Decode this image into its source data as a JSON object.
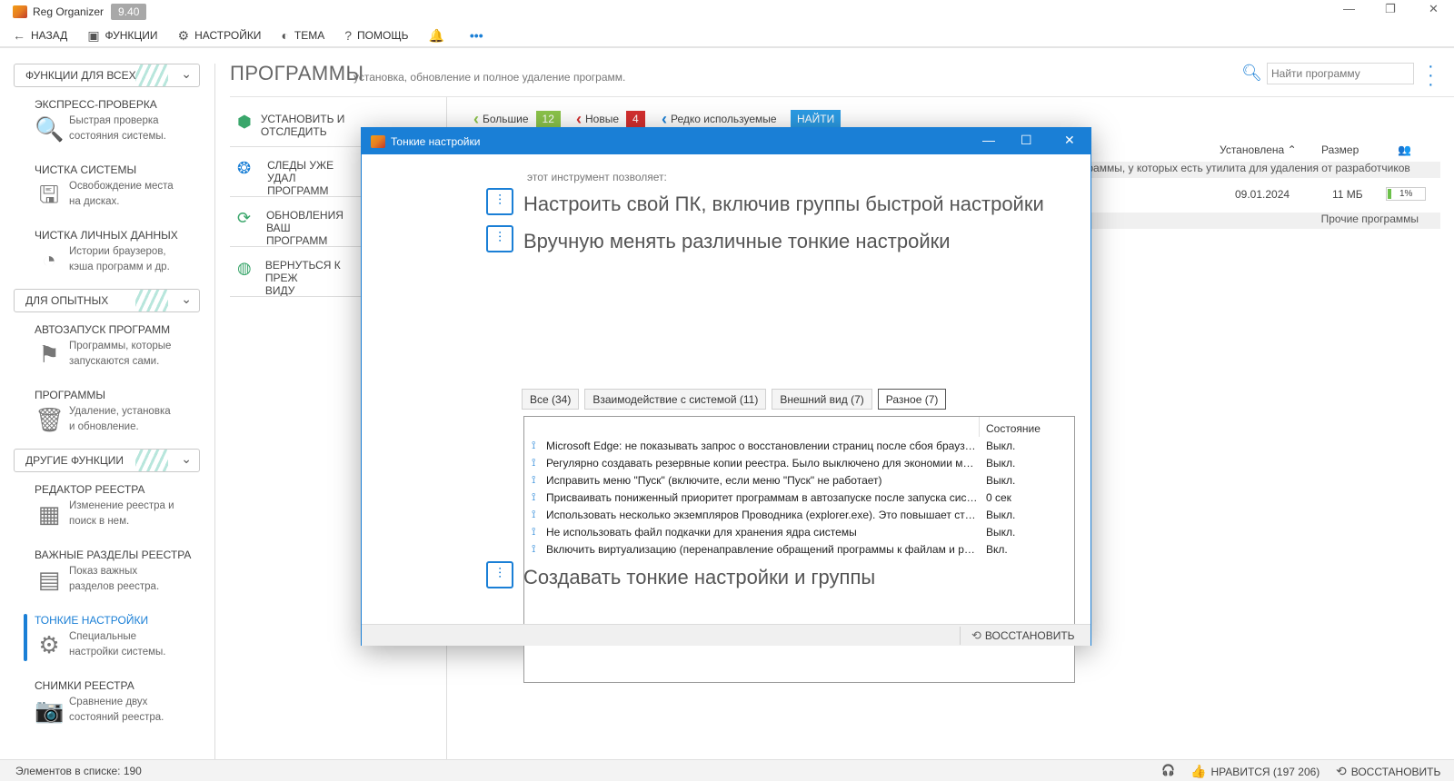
{
  "app": {
    "title": "Reg Organizer",
    "version": "9.40",
    "minimize": "—",
    "restore": "❐",
    "close": "✕"
  },
  "menu": [
    {
      "icon": "←",
      "label": "НАЗАД"
    },
    {
      "icon": "▣",
      "label": "ФУНКЦИИ"
    },
    {
      "icon": "⚙",
      "label": "НАСТРОЙКИ"
    },
    {
      "icon": "◐",
      "label": "ТЕМА"
    },
    {
      "icon": "?",
      "label": "ПОМОЩЬ"
    },
    {
      "icon": "🔔",
      "label": ""
    },
    {
      "icon": "•••",
      "label": ""
    }
  ],
  "sidebar": {
    "sections": [
      {
        "label": "ФУНКЦИИ ДЛЯ ВСЕХ"
      },
      {
        "label": "ДЛЯ ОПЫТНЫХ"
      },
      {
        "label": "ДРУГИЕ ФУНКЦИИ"
      }
    ],
    "items": [
      {
        "title": "ЭКСПРЕСС-ПРОВЕРКА",
        "desc1": "Быстрая проверка",
        "desc2": "состояния системы."
      },
      {
        "title": "ЧИСТКА СИСТЕМЫ",
        "desc1": "Освобождение места",
        "desc2": "на дисках."
      },
      {
        "title": "ЧИСТКА ЛИЧНЫХ ДАННЫХ",
        "desc1": "Истории браузеров,",
        "desc2": "кэша программ и др."
      },
      {
        "title": "АВТОЗАПУСК ПРОГРАММ",
        "desc1": "Программы, которые",
        "desc2": "запускаются сами."
      },
      {
        "title": "ПРОГРАММЫ",
        "desc1": "Удаление, установка",
        "desc2": "и обновление."
      },
      {
        "title": "РЕДАКТОР РЕЕСТРА",
        "desc1": "Изменение реестра и",
        "desc2": "поиск в нем."
      },
      {
        "title": "ВАЖНЫЕ РАЗДЕЛЫ РЕЕСТРА",
        "desc1": "Показ важных",
        "desc2": "разделов реестра."
      },
      {
        "title": "ТОНКИЕ НАСТРОЙКИ",
        "desc1": "Специальные",
        "desc2": "настройки системы."
      },
      {
        "title": "СНИМКИ РЕЕСТРА",
        "desc1": "Сравнение двух",
        "desc2": "состояний реестра."
      }
    ]
  },
  "main": {
    "title": "ПРОГРАММЫ",
    "subtitle": "установка, обновление и полное удаление программ.",
    "search_placeholder": "Найти программу",
    "actions": [
      {
        "line1": "УСТАНОВИТЬ И ОТСЛЕДИТЬ",
        "line2": ""
      },
      {
        "line1": "СЛЕДЫ УЖЕ УДАЛ",
        "line2": "ПРОГРАММ"
      },
      {
        "line1": "ОБНОВЛЕНИЯ ВАШ",
        "line2": "ПРОГРАММ"
      },
      {
        "line1": "ВЕРНУТЬСЯ К ПРЕЖ",
        "line2": "ВИДУ"
      }
    ],
    "filters": [
      {
        "label": "Большие",
        "count": "12",
        "color": "#8bc34a"
      },
      {
        "label": "Новые",
        "count": "4",
        "color": "#d32f2f"
      },
      {
        "label": "Редко используемые",
        "count": "",
        "color": "#1a7fd6"
      }
    ],
    "find_label": "НАЙТИ",
    "columns": {
      "installed": "Установлена",
      "size": "Размер"
    },
    "group_label": "граммы, у которых есть утилита для удаления от разработчиков",
    "row": {
      "date": "09.01.2024",
      "size": "11 МБ",
      "percent": "1%"
    },
    "other_label": "Прочие программы"
  },
  "status": {
    "count": "Элементов в списке: 190",
    "like": "НРАВИТСЯ (197 206)",
    "restore": "ВОССТАНОВИТЬ"
  },
  "dialog": {
    "title": "Тонкие настройки",
    "intro": "этот инструмент позволяет:",
    "heading1": "Настроить свой ПК, включив группы быстрой настройки",
    "heading2": "Вручную менять различные тонкие настройки",
    "heading3": "Создавать тонкие настройки и группы",
    "tabs": [
      {
        "label": "Все (34)"
      },
      {
        "label": "Взаимодействие с системой (11)"
      },
      {
        "label": "Внешний вид (7)"
      },
      {
        "label": "Разное (7)"
      }
    ],
    "state_header": "Состояние",
    "rows": [
      {
        "text": "Microsoft Edge: не показывать запрос о восстановлении страниц после сбоя браузера",
        "value": "Выкл."
      },
      {
        "text": "Регулярно создавать резервные копии реестра. Было выключено для экономии места на диске",
        "value": "Выкл."
      },
      {
        "text": "Исправить меню \"Пуск\" (включите, если меню \"Пуск\" не работает)",
        "value": "Выкл."
      },
      {
        "text": "Присваивать пониженный приоритет программам в автозапуске после запуска системы",
        "value": "0 сек"
      },
      {
        "text": "Использовать несколько экземпляров Проводника (explorer.exe). Это повышает стабильность",
        "value": "Выкл."
      },
      {
        "text": "Не использовать файл подкачки для хранения ядра системы",
        "value": "Выкл."
      },
      {
        "text": "Включить виртуализацию (перенаправление обращений программы к файлам и реестру)",
        "value": "Вкл."
      }
    ],
    "restore": "ВОССТАНОВИТЬ"
  }
}
